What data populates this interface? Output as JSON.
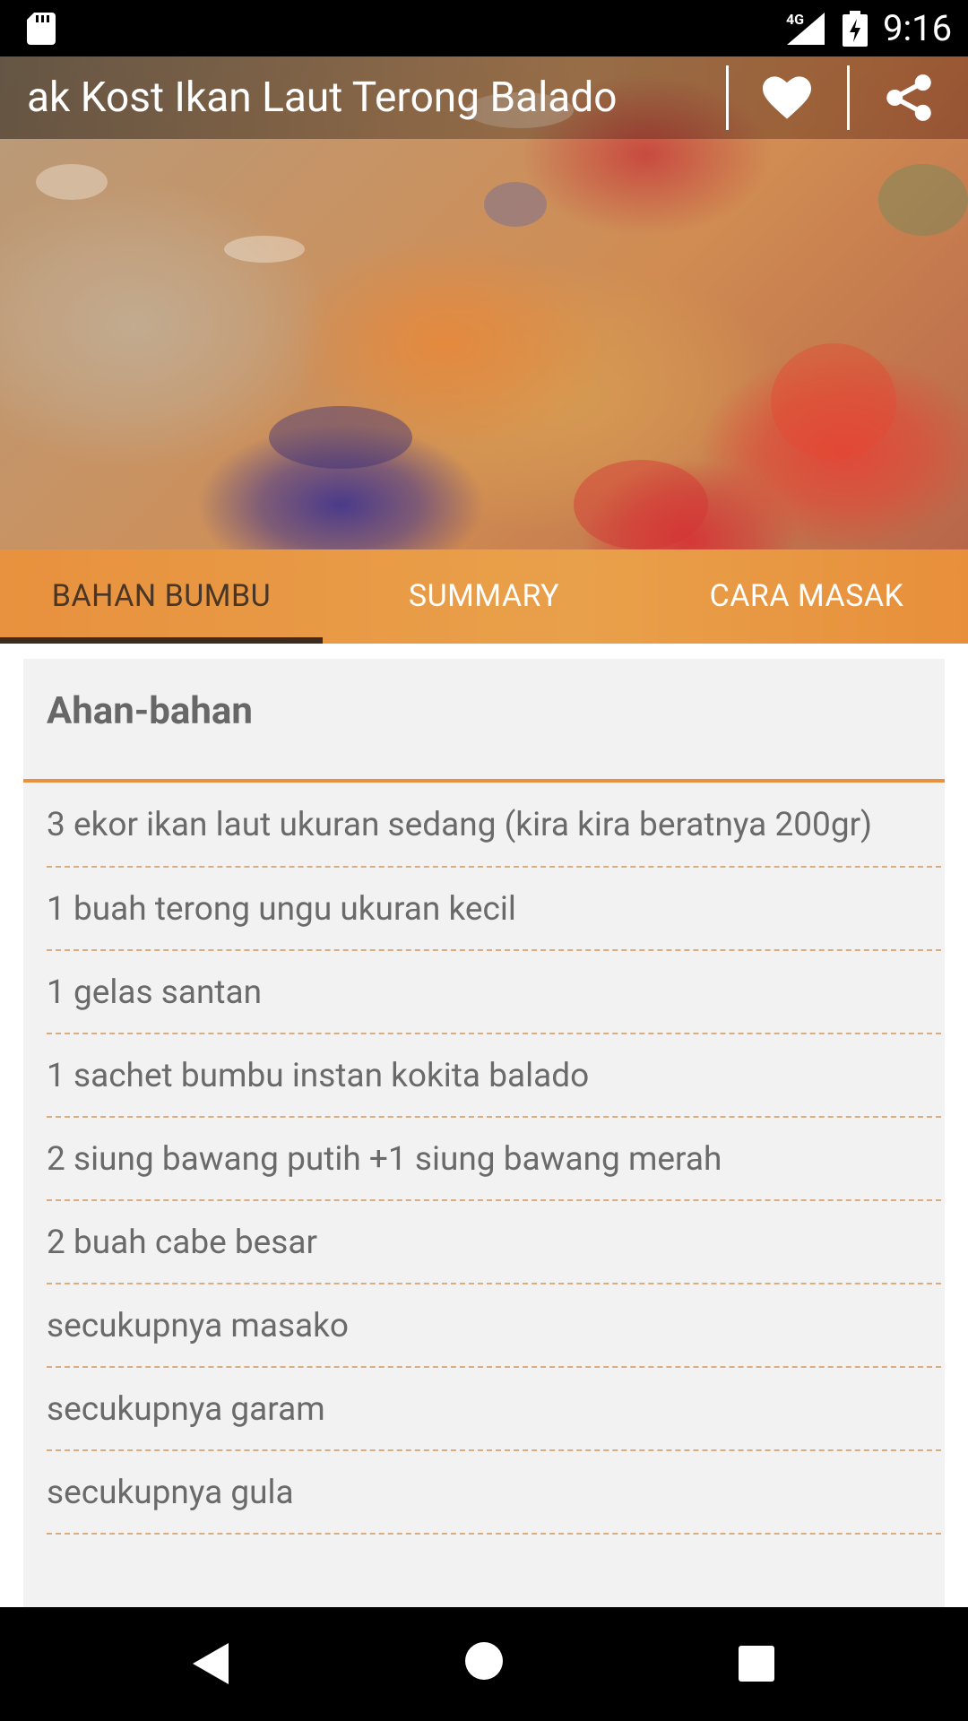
{
  "status_bar": {
    "network": "4G",
    "time": "9:16"
  },
  "toolbar": {
    "title": "ak Kost  Ikan Laut Terong Balado",
    "favorite_icon": "heart-icon",
    "share_icon": "share-icon"
  },
  "tabs": [
    {
      "label": "BAHAN BUMBU",
      "active": true
    },
    {
      "label": "SUMMARY",
      "active": false
    },
    {
      "label": "CARA MASAK",
      "active": false
    }
  ],
  "ingredients": {
    "heading": "Ahan-bahan",
    "items": [
      "3 ekor ikan laut ukuran sedang (kira kira beratnya 200gr)",
      "1 buah terong ungu ukuran kecil",
      "1 gelas santan",
      "1 sachet bumbu instan kokita balado",
      "2 siung bawang putih +1 siung bawang merah",
      "2 buah cabe besar",
      "secukupnya masako",
      "secukupnya garam",
      "secukupnya gula"
    ]
  },
  "colors": {
    "accent": "#e8913e",
    "active_tab_text": "#4a3626",
    "card_bg": "#f2f2f2",
    "text": "#6a6a6a",
    "divider_dashed": "#d9ad80"
  },
  "nav_bar": {
    "back_icon": "back-triangle-icon",
    "home_icon": "home-circle-icon",
    "recents_icon": "recents-square-icon"
  }
}
